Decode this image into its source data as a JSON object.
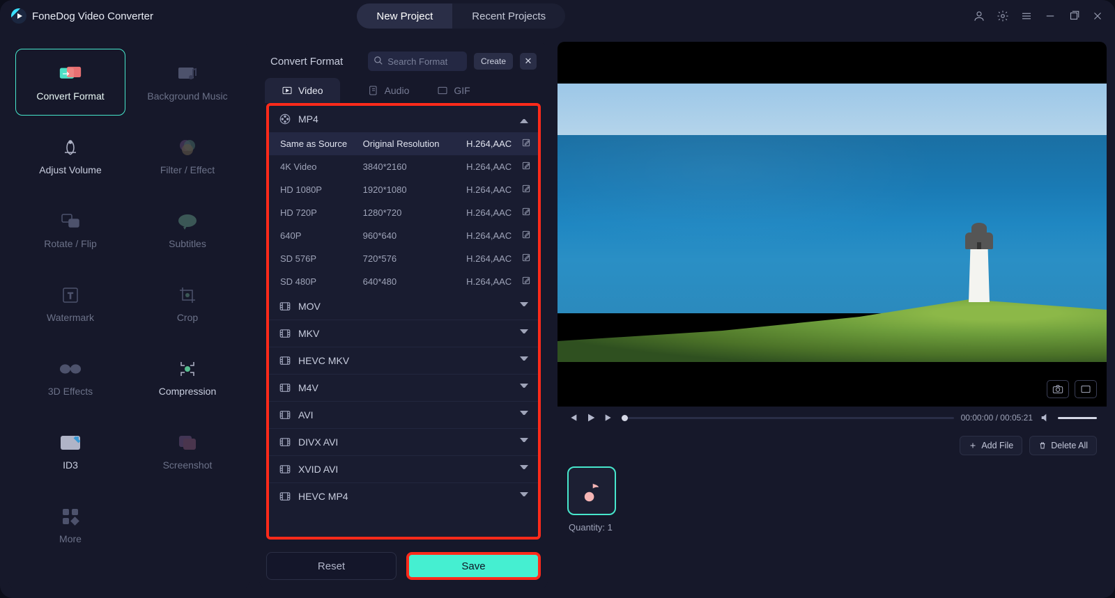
{
  "app": {
    "title": "FoneDog Video Converter"
  },
  "topTabs": {
    "newProject": "New Project",
    "recentProjects": "Recent Projects"
  },
  "tools": {
    "convertFormat": "Convert Format",
    "backgroundMusic": "Background Music",
    "adjustVolume": "Adjust Volume",
    "filterEffect": "Filter / Effect",
    "rotateFlip": "Rotate / Flip",
    "subtitles": "Subtitles",
    "watermark": "Watermark",
    "crop": "Crop",
    "threeDEffects": "3D Effects",
    "compression": "Compression",
    "id3": "ID3",
    "screenshot": "Screenshot",
    "more": "More"
  },
  "panel": {
    "title": "Convert Format",
    "searchPlaceholder": "Search Format",
    "create": "Create",
    "tabs": {
      "video": "Video",
      "audio": "Audio",
      "gif": "GIF"
    }
  },
  "formats": {
    "mp4": {
      "label": "MP4",
      "rows": [
        {
          "name": "Same as Source",
          "res": "Original Resolution",
          "codec": "H.264,AAC"
        },
        {
          "name": "4K Video",
          "res": "3840*2160",
          "codec": "H.264,AAC"
        },
        {
          "name": "HD 1080P",
          "res": "1920*1080",
          "codec": "H.264,AAC"
        },
        {
          "name": "HD 720P",
          "res": "1280*720",
          "codec": "H.264,AAC"
        },
        {
          "name": "640P",
          "res": "960*640",
          "codec": "H.264,AAC"
        },
        {
          "name": "SD 576P",
          "res": "720*576",
          "codec": "H.264,AAC"
        },
        {
          "name": "SD 480P",
          "res": "640*480",
          "codec": "H.264,AAC"
        }
      ]
    },
    "groups": [
      "MOV",
      "MKV",
      "HEVC MKV",
      "M4V",
      "AVI",
      "DIVX AVI",
      "XVID AVI",
      "HEVC MP4"
    ]
  },
  "footer": {
    "reset": "Reset",
    "save": "Save"
  },
  "player": {
    "time": "00:00:00 / 00:05:21"
  },
  "files": {
    "addFile": "Add File",
    "deleteAll": "Delete All",
    "quantity": "Quantity: 1"
  }
}
